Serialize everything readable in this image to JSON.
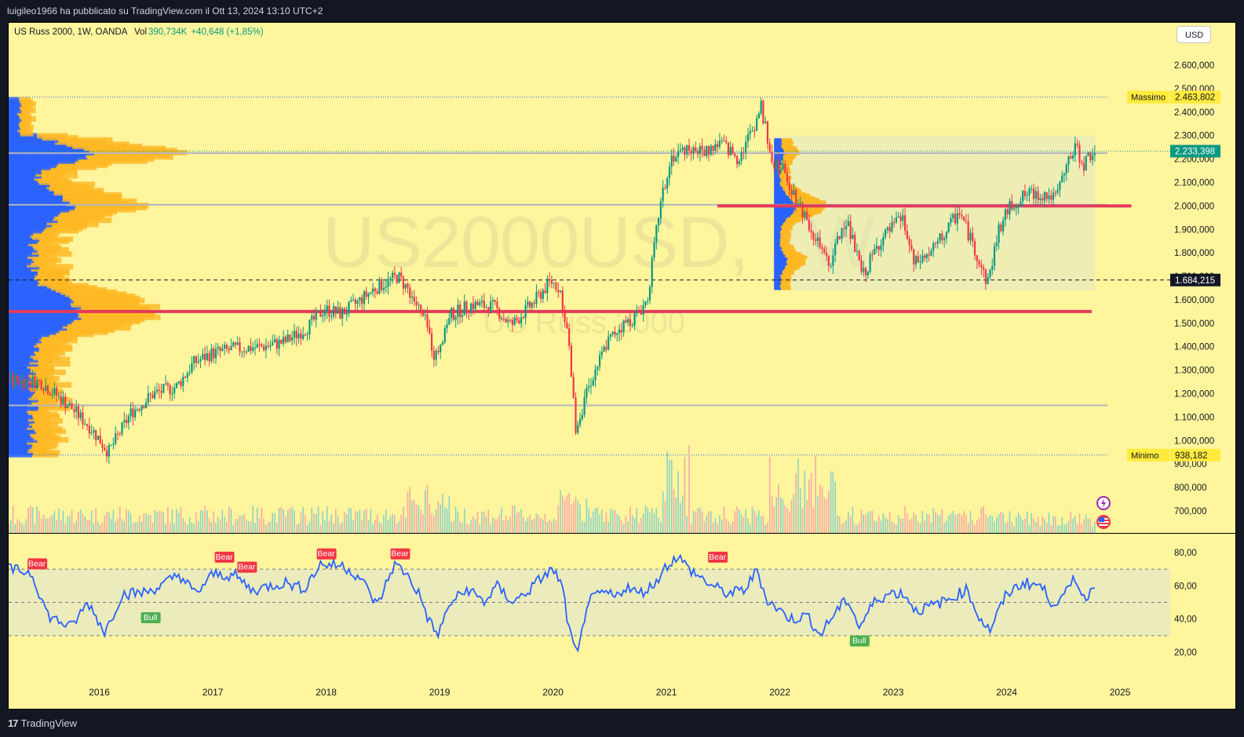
{
  "header": {
    "publish_text": "luigileo1966 ha pubblicato su TradingView.com il Ott 13, 2024 13:10 UTC+2"
  },
  "chart": {
    "symbol_label": "US Russ 2000, 1W, OANDA",
    "vol_label": "Vol",
    "vol_value": "390,734K",
    "change_text": "+40,648 (+1,85%)",
    "currency_button": "USD",
    "watermark_symbol": "US2000USD, 1W",
    "watermark_name": "US Russ 2000",
    "max_label": "Massimo",
    "min_label": "Minimo",
    "brand": "TradingView",
    "colors": {
      "background": "#fff59d",
      "up_candle": "#089981",
      "down_candle": "#f23645",
      "rsi_line": "#2962ff",
      "profile_blue": "#2962ff",
      "profile_orange": "#ffb823",
      "level_red": "#e33a5a",
      "bear_label": "#f23645",
      "bull_label": "#4caf50"
    },
    "icons": [
      "flash-icon",
      "us-flag-icon"
    ]
  },
  "chart_data": [
    {
      "type": "candlestick",
      "title": "US Russ 2000, 1W, OANDA",
      "y_ticks": [
        "2.600,000",
        "2.500,000",
        "2.400,000",
        "2.300,000",
        "2.200,000",
        "2.100,000",
        "2.000,000",
        "1.900,000",
        "1.800,000",
        "1.700,000",
        "1.600,000",
        "1.500,000",
        "1.400,000",
        "1.300,000",
        "1.200,000",
        "1.100,000",
        "1.000,000",
        "900,000",
        "800,000",
        "700,000"
      ],
      "ylim": [
        640,
        2690
      ],
      "x_ticks": [
        "2016",
        "2017",
        "2018",
        "2019",
        "2020",
        "2021",
        "2022",
        "2023",
        "2024",
        "2025"
      ],
      "xlim": [
        2015.2,
        2025.2
      ],
      "price_labels": [
        {
          "label": "2.463,802",
          "value": 2463.802,
          "kind": "max"
        },
        {
          "label": "2.233,398",
          "value": 2233.398,
          "kind": "last"
        },
        {
          "label": "1.684,215",
          "value": 1684.215,
          "kind": "crosshair"
        },
        {
          "label": "938,182",
          "value": 938.182,
          "kind": "min"
        }
      ],
      "horizontal_levels": [
        {
          "value": 2463.802,
          "style": "dotted-blue"
        },
        {
          "value": 2233.398,
          "style": "dotted-teal"
        },
        {
          "value": 2225,
          "style": "gray"
        },
        {
          "value": 2005,
          "style": "gray"
        },
        {
          "value": 1684.215,
          "style": "dashed-black"
        },
        {
          "value": 1550,
          "style": "red-thick",
          "from": 2015.2,
          "to": 2024.75
        },
        {
          "value": 2000,
          "style": "red-thick",
          "from": 2021.45,
          "to": 2025.1
        },
        {
          "value": 1150,
          "style": "gray"
        },
        {
          "value": 938.182,
          "style": "dotted-blue"
        }
      ],
      "anchors": [
        [
          2015.2,
          1260
        ],
        [
          2015.5,
          1250
        ],
        [
          2015.75,
          1150
        ],
        [
          2015.95,
          1050
        ],
        [
          2016.1,
          950
        ],
        [
          2016.3,
          1120
        ],
        [
          2016.5,
          1200
        ],
        [
          2016.7,
          1230
        ],
        [
          2016.85,
          1330
        ],
        [
          2017.0,
          1370
        ],
        [
          2017.2,
          1390
        ],
        [
          2017.45,
          1400
        ],
        [
          2017.65,
          1420
        ],
        [
          2017.85,
          1480
        ],
        [
          2018.0,
          1560
        ],
        [
          2018.15,
          1540
        ],
        [
          2018.3,
          1590
        ],
        [
          2018.45,
          1650
        ],
        [
          2018.65,
          1700
        ],
        [
          2018.75,
          1640
        ],
        [
          2018.9,
          1500
        ],
        [
          2018.98,
          1350
        ],
        [
          2019.1,
          1530
        ],
        [
          2019.3,
          1580
        ],
        [
          2019.5,
          1570
        ],
        [
          2019.65,
          1490
        ],
        [
          2019.85,
          1590
        ],
        [
          2020.0,
          1680
        ],
        [
          2020.08,
          1650
        ],
        [
          2020.15,
          1450
        ],
        [
          2020.22,
          1050
        ],
        [
          2020.35,
          1250
        ],
        [
          2020.5,
          1420
        ],
        [
          2020.6,
          1480
        ],
        [
          2020.75,
          1530
        ],
        [
          2020.85,
          1600
        ],
        [
          2020.95,
          1960
        ],
        [
          2021.05,
          2200
        ],
        [
          2021.2,
          2250
        ],
        [
          2021.35,
          2230
        ],
        [
          2021.5,
          2270
        ],
        [
          2021.65,
          2200
        ],
        [
          2021.8,
          2350
        ],
        [
          2021.85,
          2430
        ],
        [
          2021.95,
          2200
        ],
        [
          2022.05,
          2150
        ],
        [
          2022.15,
          2050
        ],
        [
          2022.3,
          1900
        ],
        [
          2022.45,
          1740
        ],
        [
          2022.6,
          1950
        ],
        [
          2022.75,
          1700
        ],
        [
          2022.9,
          1850
        ],
        [
          2023.0,
          1900
        ],
        [
          2023.1,
          1950
        ],
        [
          2023.2,
          1750
        ],
        [
          2023.35,
          1800
        ],
        [
          2023.5,
          1900
        ],
        [
          2023.6,
          1980
        ],
        [
          2023.75,
          1800
        ],
        [
          2023.85,
          1670
        ],
        [
          2023.95,
          1900
        ],
        [
          2024.05,
          2000
        ],
        [
          2024.2,
          2050
        ],
        [
          2024.35,
          2050
        ],
        [
          2024.45,
          2030
        ],
        [
          2024.55,
          2170
        ],
        [
          2024.62,
          2250
        ],
        [
          2024.7,
          2180
        ],
        [
          2024.78,
          2233
        ]
      ],
      "volume_profile_left": {
        "price_range": [
          940,
          2460
        ],
        "poc": 1550
      },
      "volume_profile_range": {
        "price_range": [
          1640,
          2300
        ],
        "from": 2021.95,
        "to": 2024.78,
        "poc": 2000
      }
    },
    {
      "type": "line",
      "name": "RSI",
      "y_ticks": [
        "80,00",
        "60,00",
        "40,00",
        "20,00"
      ],
      "ylim": [
        10,
        90
      ],
      "bands": [
        30,
        50,
        70
      ],
      "anchors": [
        [
          2015.2,
          70
        ],
        [
          2015.4,
          68
        ],
        [
          2015.55,
          42
        ],
        [
          2015.75,
          35
        ],
        [
          2015.9,
          50
        ],
        [
          2016.05,
          32
        ],
        [
          2016.2,
          55
        ],
        [
          2016.4,
          56
        ],
        [
          2016.55,
          60
        ],
        [
          2016.7,
          67
        ],
        [
          2016.85,
          55
        ],
        [
          2017.0,
          67
        ],
        [
          2017.2,
          66
        ],
        [
          2017.35,
          57
        ],
        [
          2017.5,
          60
        ],
        [
          2017.65,
          62
        ],
        [
          2017.8,
          58
        ],
        [
          2017.95,
          73
        ],
        [
          2018.15,
          72
        ],
        [
          2018.3,
          65
        ],
        [
          2018.45,
          48
        ],
        [
          2018.6,
          73
        ],
        [
          2018.7,
          68
        ],
        [
          2018.82,
          55
        ],
        [
          2018.9,
          40
        ],
        [
          2018.98,
          30
        ],
        [
          2019.1,
          50
        ],
        [
          2019.25,
          58
        ],
        [
          2019.4,
          50
        ],
        [
          2019.5,
          60
        ],
        [
          2019.65,
          50
        ],
        [
          2019.8,
          58
        ],
        [
          2019.9,
          65
        ],
        [
          2020.0,
          70
        ],
        [
          2020.08,
          60
        ],
        [
          2020.15,
          30
        ],
        [
          2020.22,
          18
        ],
        [
          2020.3,
          50
        ],
        [
          2020.45,
          56
        ],
        [
          2020.55,
          53
        ],
        [
          2020.65,
          60
        ],
        [
          2020.75,
          55
        ],
        [
          2020.88,
          60
        ],
        [
          2021.0,
          72
        ],
        [
          2021.1,
          78
        ],
        [
          2021.2,
          70
        ],
        [
          2021.4,
          60
        ],
        [
          2021.55,
          55
        ],
        [
          2021.7,
          58
        ],
        [
          2021.8,
          70
        ],
        [
          2021.88,
          52
        ],
        [
          2022.0,
          45
        ],
        [
          2022.1,
          40
        ],
        [
          2022.25,
          42
        ],
        [
          2022.35,
          30
        ],
        [
          2022.5,
          45
        ],
        [
          2022.6,
          52
        ],
        [
          2022.7,
          35
        ],
        [
          2022.85,
          52
        ],
        [
          2023.0,
          56
        ],
        [
          2023.1,
          55
        ],
        [
          2023.2,
          45
        ],
        [
          2023.35,
          48
        ],
        [
          2023.5,
          52
        ],
        [
          2023.65,
          58
        ],
        [
          2023.75,
          42
        ],
        [
          2023.85,
          33
        ],
        [
          2024.0,
          55
        ],
        [
          2024.15,
          62
        ],
        [
          2024.3,
          60
        ],
        [
          2024.4,
          50
        ],
        [
          2024.5,
          52
        ],
        [
          2024.6,
          66
        ],
        [
          2024.68,
          52
        ],
        [
          2024.75,
          58
        ],
        [
          2024.78,
          59
        ]
      ],
      "signals": [
        {
          "label": "Bear",
          "x": 2015.45,
          "y": 68,
          "kind": "bear"
        },
        {
          "label": "Bull",
          "x": 2016.45,
          "y": 46,
          "kind": "bull"
        },
        {
          "label": "Bear",
          "x": 2017.1,
          "y": 72,
          "kind": "bear"
        },
        {
          "label": "Bear",
          "x": 2017.3,
          "y": 66,
          "kind": "bear"
        },
        {
          "label": "Bear",
          "x": 2018.0,
          "y": 74,
          "kind": "bear"
        },
        {
          "label": "Bear",
          "x": 2018.65,
          "y": 74,
          "kind": "bear"
        },
        {
          "label": "Bear",
          "x": 2021.45,
          "y": 72,
          "kind": "bear"
        },
        {
          "label": "Bull",
          "x": 2022.7,
          "y": 32,
          "kind": "bull"
        }
      ]
    }
  ]
}
